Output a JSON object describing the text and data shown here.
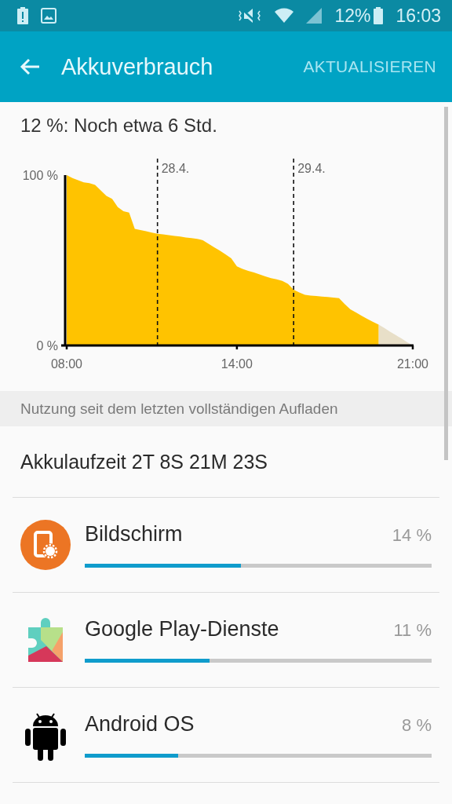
{
  "status_bar": {
    "battery_percent": "12%",
    "time": "16:03"
  },
  "app_bar": {
    "title": "Akkuverbrauch",
    "action": "AKTUALISIEREN"
  },
  "estimate": "12 %: Noch etwa 6 Std.",
  "chart": {
    "chart_data": {
      "type": "area",
      "categories": [
        "08:00",
        null,
        null,
        null,
        null,
        null,
        null,
        null,
        null,
        null,
        null,
        null,
        null,
        null,
        null,
        null,
        null,
        null,
        null,
        null,
        null,
        null,
        null,
        null,
        null,
        null,
        null,
        null,
        null,
        null,
        "14:00",
        null,
        null,
        null,
        null,
        null,
        null,
        null,
        null,
        null,
        null,
        null,
        null,
        null,
        null,
        null,
        null,
        null,
        null,
        null,
        null,
        null,
        null,
        null,
        null,
        null,
        null,
        null,
        null,
        null,
        null,
        "21:00"
      ],
      "series": [
        {
          "color": "#ffc300",
          "values": [
            100,
            98.3,
            97.0,
            95.7,
            95.3,
            94.2,
            91.0,
            87.8,
            86.1,
            81.2,
            78.8,
            78.0,
            68.4,
            67.7,
            67.0,
            66.3,
            65.6,
            65.2,
            64.7,
            64.3,
            63.9,
            63.4,
            63.0,
            62.6,
            61.8,
            59.7,
            57.6,
            55.6,
            53.4,
            51.2,
            46.4,
            44.9,
            43.8,
            42.8,
            41.7,
            40.6,
            39.5,
            38.8,
            37.9,
            36.2,
            32.7,
            31.1,
            29.7,
            29.3,
            29.0,
            28.7,
            28.4,
            28.1,
            27.8,
            24.3,
            21.2,
            19.3,
            17.4,
            15.5,
            13.8,
            12.2,
            null,
            null,
            null,
            null,
            null,
            null
          ]
        },
        {
          "color": "#e8dfc8",
          "values": [
            null,
            null,
            null,
            null,
            null,
            null,
            null,
            null,
            null,
            null,
            null,
            null,
            null,
            null,
            null,
            null,
            null,
            null,
            null,
            null,
            null,
            null,
            null,
            null,
            null,
            null,
            null,
            null,
            null,
            null,
            null,
            null,
            null,
            null,
            null,
            null,
            null,
            null,
            null,
            null,
            null,
            null,
            null,
            null,
            null,
            null,
            null,
            null,
            null,
            null,
            null,
            null,
            null,
            null,
            null,
            12.2,
            10.2,
            8.1,
            6.1,
            4.1,
            2.0,
            0
          ]
        }
      ],
      "ylim": [
        0,
        100
      ],
      "yticks": [
        {
          "value": 0,
          "label": "0 %"
        },
        {
          "value": 100,
          "label": "100 %"
        }
      ],
      "annotations": [
        "28.4.",
        "29.4."
      ]
    }
  },
  "section_header": "Nutzung seit dem letzten vollständigen Aufladen",
  "battery_time": "Akkulaufzeit 2T 8S 21M 23S",
  "apps": [
    {
      "kind": "display",
      "name": "Bildschirm",
      "percent": "14 %",
      "level": 0.45
    },
    {
      "kind": "play-services",
      "name": "Google Play-Dienste",
      "percent": "11 %",
      "level": 0.36
    },
    {
      "kind": "android",
      "name": "Android OS",
      "percent": "8 %",
      "level": 0.27
    }
  ]
}
